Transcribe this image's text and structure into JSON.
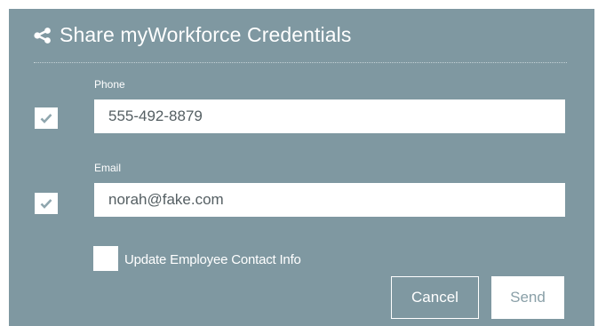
{
  "dialog": {
    "title": "Share myWorkforce Credentials",
    "icon": "share-icon"
  },
  "phone": {
    "label": "Phone",
    "value": "555-492-8879",
    "checked": true
  },
  "email": {
    "label": "Email",
    "value": "norah@fake.com",
    "checked": true
  },
  "update_contact": {
    "label": "Update Employee Contact Info",
    "checked": false
  },
  "buttons": {
    "cancel": "Cancel",
    "send": "Send"
  },
  "colors": {
    "dialog_background": "#7f98a1",
    "check_mark": "#8fa6ae"
  }
}
